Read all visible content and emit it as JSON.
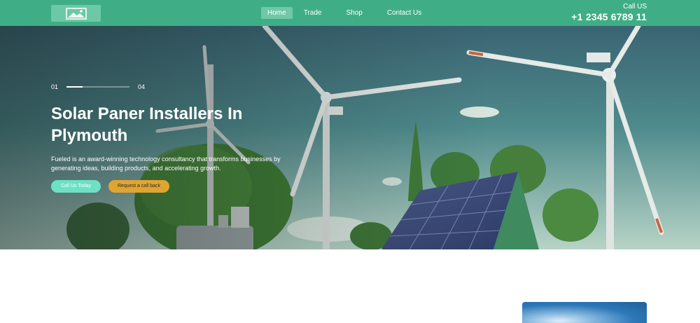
{
  "header": {
    "logo": "image-placeholder-icon",
    "nav": [
      {
        "label": "Home",
        "active": true
      },
      {
        "label": "Trade",
        "active": false
      },
      {
        "label": "Shop",
        "active": false
      },
      {
        "label": "Contact Us",
        "active": false
      }
    ],
    "call_label": "Call US",
    "call_number": "+1 2345 6789 11"
  },
  "hero": {
    "slider": {
      "current": "01",
      "total": "04",
      "progress": 0.25
    },
    "title": "Solar Paner Installers In Plymouth",
    "description": "Fueled is an award-winning technology consultancy that transforms businesses by generating ideas, building products, and accelerating growth.",
    "primary_button": "Call Us Today",
    "secondary_button": "Request a call back"
  },
  "colors": {
    "header_bg": "#3fae87",
    "nav_active_bg": "#70c8a7",
    "primary_button": "#6ee0c4",
    "secondary_button": "#e0a531"
  }
}
